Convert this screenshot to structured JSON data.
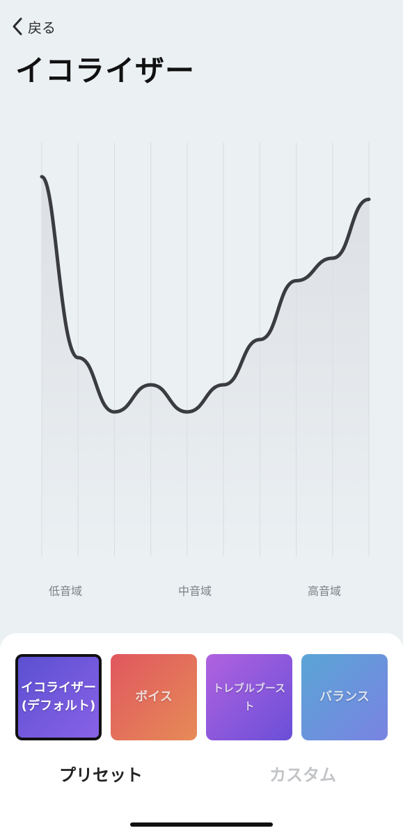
{
  "nav": {
    "back_label": "戻る"
  },
  "page": {
    "title": "イコライザー"
  },
  "chart_data": {
    "type": "area",
    "title": "",
    "xlabel": "",
    "ylabel": "",
    "grid": true,
    "curve_color": "#3a3c40",
    "fill_color": "#dcdfe3",
    "bands": [
      1,
      2,
      3,
      4,
      5,
      6,
      7,
      8,
      9,
      10
    ],
    "levels": [
      0.84,
      0.44,
      0.32,
      0.38,
      0.32,
      0.38,
      0.48,
      0.61,
      0.66,
      0.79
    ],
    "band_labels": [
      "低音域",
      "中音域",
      "高音域"
    ]
  },
  "presets": [
    {
      "label": "イコライザー\n(デフォルト)",
      "selected": true,
      "colors": [
        "#5a4fd0",
        "#8a62e8"
      ]
    },
    {
      "label": "ボイス",
      "selected": false,
      "colors": [
        "#e0575f",
        "#e68b57"
      ]
    },
    {
      "label": "トレブルブースト",
      "selected": false,
      "colors": [
        "#b062df",
        "#6a4fd8"
      ]
    },
    {
      "label": "バランス",
      "selected": false,
      "colors": [
        "#5aa5d6",
        "#7a83e2"
      ]
    }
  ],
  "tabs": {
    "preset": "プリセット",
    "custom": "カスタム",
    "active_color": "#222222",
    "inactive_color": "#c2c4c7"
  }
}
